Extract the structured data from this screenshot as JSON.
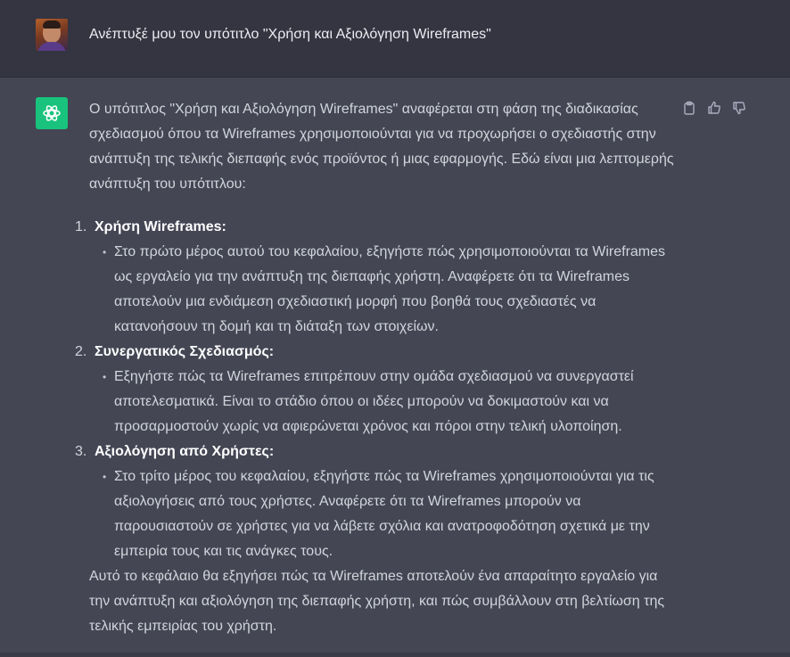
{
  "user_message": {
    "text": "Ανέπτυξέ μου τον υπότιτλο \"Χρήση και Αξιολόγηση Wireframes\""
  },
  "assistant_message": {
    "intro": "Ο υπότιτλος \"Χρήση και Αξιολόγηση Wireframes\" αναφέρεται στη φάση της διαδικασίας σχεδιασμού όπου τα Wireframes χρησιμοποιούνται για να προχωρήσει ο σχεδιαστής στην ανάπτυξη της τελικής διεπαφής ενός προϊόντος ή μιας εφαρμογής. Εδώ είναι μια λεπτομερής ανάπτυξη του υπότιτλου:",
    "sections": [
      {
        "number": "1.",
        "title": "Χρήση Wireframes:",
        "bullet": "Στο πρώτο μέρος αυτού του κεφαλαίου, εξηγήστε πώς χρησιμοποιούνται τα Wireframes ως εργαλείο για την ανάπτυξη της διεπαφής χρήστη. Αναφέρετε ότι τα Wireframes αποτελούν μια ενδιάμεση σχεδιαστική μορφή που βοηθά τους σχεδιαστές να κατανοήσουν τη δομή και τη διάταξη των στοιχείων."
      },
      {
        "number": "2.",
        "title": "Συνεργατικός Σχεδιασμός:",
        "bullet": "Εξηγήστε πώς τα Wireframes επιτρέπουν στην ομάδα σχεδιασμού να συνεργαστεί αποτελεσματικά. Είναι το στάδιο όπου οι ιδέες μπορούν να δοκιμαστούν και να προσαρμοστούν χωρίς να αφιερώνεται χρόνος και πόροι στην τελική υλοποίηση."
      },
      {
        "number": "3.",
        "title": "Αξιολόγηση από Χρήστες:",
        "bullet": "Στο τρίτο μέρος του κεφαλαίου, εξηγήστε πώς τα Wireframes χρησιμοποιούνται για τις αξιολογήσεις από τους χρήστες. Αναφέρετε ότι τα Wireframes μπορούν να παρουσιαστούν σε χρήστες για να λάβετε σχόλια και ανατροφοδότηση σχετικά με την εμπειρία τους και τις ανάγκες τους."
      }
    ],
    "closing": "Αυτό το κεφάλαιο θα εξηγήσει πώς τα Wireframes αποτελούν ένα απαραίτητο εργαλείο για την ανάπτυξη και αξιολόγηση της διεπαφής χρήστη, και πώς συμβάλλουν στη βελτίωση της τελικής εμπειρίας του χρήστη."
  },
  "actions": {
    "icons": [
      "clipboard-icon",
      "thumbs-up-icon",
      "thumbs-down-icon"
    ]
  },
  "colors": {
    "user_bg": "#343541",
    "assistant_bg": "#444654",
    "gpt_avatar": "#19c37d",
    "text": "#d1d5db"
  }
}
